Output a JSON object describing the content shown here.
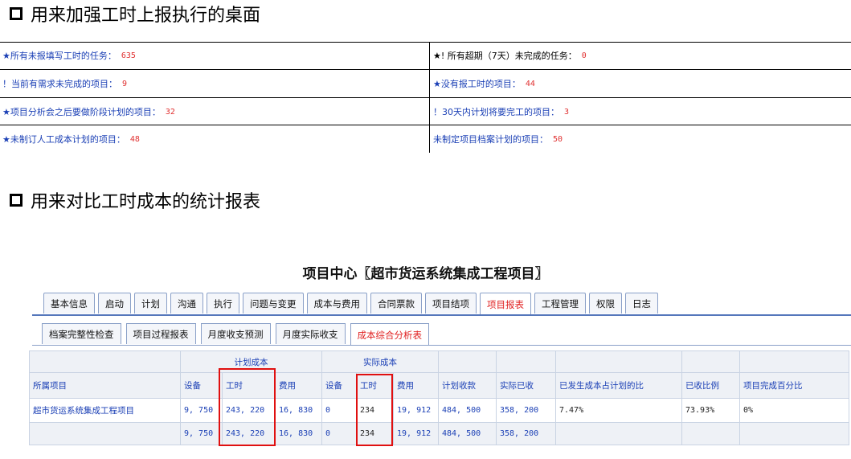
{
  "section1": {
    "heading": "用来加强工时上报执行的桌面"
  },
  "section2": {
    "heading": "用来对比工时成本的统计报表"
  },
  "dashboard": {
    "left": [
      {
        "label": "★所有未报填写工时的任务：",
        "value": "635"
      },
      {
        "label": "！当前有需求未完成的项目：",
        "value": "9"
      },
      {
        "label": "★项目分析会之后要做阶段计划的项目：",
        "value": "32"
      },
      {
        "label": "★未制订人工成本计划的项目：",
        "value": "48"
      }
    ],
    "right": [
      {
        "label": "★! 所有超期（7天）未完成的任务：",
        "value": "0"
      },
      {
        "label": "★没有报工时的项目：",
        "value": "44"
      },
      {
        "label": "！30天内计划将要完工的项目：",
        "value": "3"
      },
      {
        "label": "未制定项目档案计划的项目：",
        "value": "50"
      }
    ]
  },
  "project_center": {
    "title": "项目中心〖超市货运系统集成工程项目〗",
    "tabs": [
      "基本信息",
      "启动",
      "计划",
      "沟通",
      "执行",
      "问题与变更",
      "成本与费用",
      "合同票款",
      "项目结项",
      "项目报表",
      "工程管理",
      "权限",
      "日志"
    ],
    "active_tab": "项目报表",
    "subtabs": [
      "档案完整性检查",
      "项目过程报表",
      "月度收支预测",
      "月度实际收支",
      "成本综合分析表"
    ],
    "active_subtab": "成本综合分析表"
  },
  "table": {
    "group_planned": "计划成本",
    "group_actual": "实际成本",
    "headers": [
      "所属项目",
      "设备",
      "工时",
      "费用",
      "设备",
      "工时",
      "费用",
      "计划收款",
      "实际已收",
      "已发生成本占计划的比",
      "已收比例",
      "项目完成百分比"
    ],
    "rows": [
      [
        "超市货运系统集成工程项目",
        "9, 750",
        "243, 220",
        "16, 830",
        "0",
        "234",
        "19, 912",
        "484, 500",
        "358, 200",
        "7.47%",
        "73.93%",
        "0%"
      ],
      [
        "",
        "9, 750",
        "243, 220",
        "16, 830",
        "0",
        "234",
        "19, 912",
        "484, 500",
        "358, 200",
        "",
        "",
        ""
      ]
    ]
  },
  "colors": {
    "link_blue": "#1a3fb5",
    "value_red": "#e03030",
    "highlight_red": "#e01010"
  }
}
